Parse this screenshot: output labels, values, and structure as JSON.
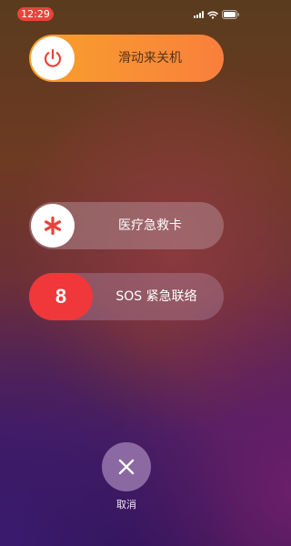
{
  "status_bar": {
    "time": "12:29",
    "icons": [
      "cellular-signal-icon",
      "wifi-icon",
      "battery-icon"
    ]
  },
  "power_off": {
    "label": "滑动来关机",
    "icon": "power-icon",
    "accent": "#f7a02a"
  },
  "medical_id": {
    "label": "医疗急救卡",
    "icon": "asterisk-icon",
    "icon_color": "#e8433a"
  },
  "emergency_sos": {
    "knob_text": "8",
    "label": "SOS 紧急联络",
    "knob_color": "#f0373a"
  },
  "cancel": {
    "label": "取消",
    "icon": "close-icon"
  }
}
